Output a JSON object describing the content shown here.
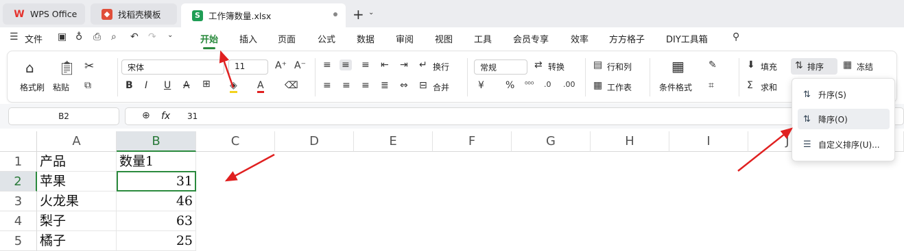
{
  "tabs": [
    {
      "label": "WPS Office",
      "icon": "wps-logo-icon",
      "color": "#e5322d"
    },
    {
      "label": "找稻壳模板",
      "icon": "docer-logo-icon",
      "color": "#e04e3a"
    },
    {
      "label": "工作簿数量.xlsx",
      "icon": "spreadsheet-s-icon",
      "color": "#1f9d55",
      "glyph": "S"
    }
  ],
  "menu": {
    "file": "文件",
    "items": [
      "开始",
      "插入",
      "页面",
      "公式",
      "数据",
      "审阅",
      "视图",
      "工具",
      "会员专享",
      "效率",
      "方方格子",
      "DIY工具箱"
    ],
    "active": "开始"
  },
  "ribbon": {
    "format_painter": "格式刷",
    "paste": "粘贴",
    "font": "宋体",
    "font_size": "11",
    "wrap": "换行",
    "merge": "合并",
    "number_format": "常规",
    "convert": "转换",
    "row_col": "行和列",
    "worksheet": "工作表",
    "cond_format": "条件格式",
    "fill": "填充",
    "sum": "求和",
    "sort": "排序",
    "freeze": "冻结"
  },
  "formula_bar": {
    "cell_ref": "B2",
    "fx": "fx",
    "value": "31"
  },
  "columns": [
    "A",
    "B",
    "C",
    "D",
    "E",
    "F",
    "G",
    "H",
    "I",
    "J"
  ],
  "rows": [
    "1",
    "2",
    "3",
    "4",
    "5"
  ],
  "cells": [
    [
      "产品",
      "数量1"
    ],
    [
      "苹果",
      "31"
    ],
    [
      "火龙果",
      "46"
    ],
    [
      "梨子",
      "63"
    ],
    [
      "橘子",
      "25"
    ]
  ],
  "sort_menu": [
    {
      "label": "升序(S)",
      "icon": "sort-ascending-icon"
    },
    {
      "label": "降序(O)",
      "icon": "sort-descending-icon"
    },
    {
      "label": "自定义排序(U)...",
      "icon": "custom-sort-icon"
    }
  ],
  "colors": {
    "accent": "#2a8a3d",
    "arrow": "#e02020"
  }
}
